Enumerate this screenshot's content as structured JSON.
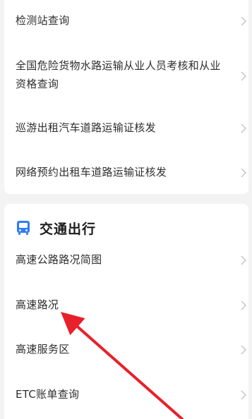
{
  "top_list": {
    "items": [
      {
        "label": "检测站查询"
      },
      {
        "label": "全国危险货物水路运输从业人员考核和从业资格查询"
      },
      {
        "label": "巡游出租汽车道路运输证核发"
      },
      {
        "label": "网络预约出租车道路运输证核发"
      }
    ]
  },
  "traffic_section": {
    "title": "交通出行",
    "icon": "bus-icon",
    "accent_color": "#2f7cf6",
    "items": [
      {
        "label": "高速公路路况简图"
      },
      {
        "label": "高速路况"
      },
      {
        "label": "高速服务区"
      },
      {
        "label": "ETC账单查询"
      }
    ]
  },
  "annotation": {
    "arrow_color": "#e8202a",
    "points_to": "高速路况"
  }
}
